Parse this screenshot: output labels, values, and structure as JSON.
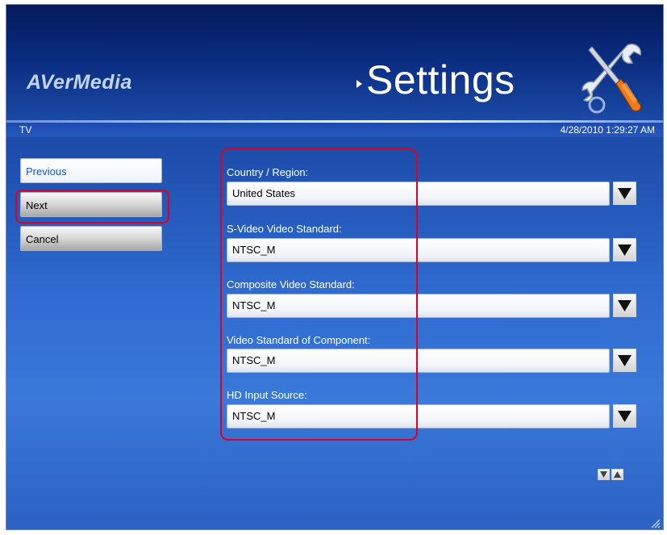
{
  "header": {
    "logo": "AVerMedia",
    "title": "Settings",
    "section": "TV",
    "timestamp": "4/28/2010 1:29:27 AM"
  },
  "nav": {
    "previous": "Previous",
    "next": "Next",
    "cancel": "Cancel"
  },
  "fields": [
    {
      "label": "Country / Region:",
      "value": "United States"
    },
    {
      "label": "S-Video Video Standard:",
      "value": "NTSC_M"
    },
    {
      "label": "Composite Video Standard:",
      "value": "NTSC_M"
    },
    {
      "label": "Video Standard of Component:",
      "value": "NTSC_M"
    },
    {
      "label": "HD Input Source:",
      "value": "NTSC_M"
    }
  ],
  "colors": {
    "highlight": "#e0001f",
    "background": "#2f6bd0",
    "header": "#0a2b7e"
  },
  "icons": [
    "tools-icon",
    "dropdown-arrow-icon",
    "page-down-icon",
    "page-up-icon",
    "resize-grip-icon"
  ]
}
